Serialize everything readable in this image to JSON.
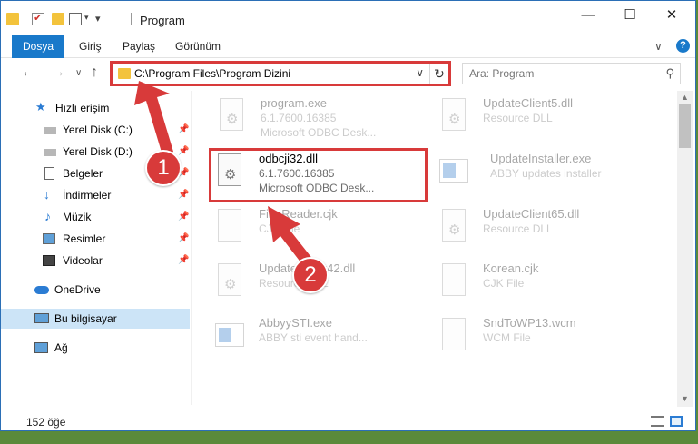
{
  "window": {
    "title": "Program"
  },
  "ribbon": {
    "tabs": [
      "Dosya",
      "Giriş",
      "Paylaş",
      "Görünüm"
    ]
  },
  "address": {
    "path": "C:\\Program Files\\Program Dizini"
  },
  "search": {
    "placeholder": "Ara: Program"
  },
  "sidebar": {
    "items": [
      {
        "label": "Hızlı erişim",
        "icon": "star-icon"
      },
      {
        "label": "Yerel Disk (C:)",
        "icon": "drive-icon"
      },
      {
        "label": "Yerel Disk (D:)",
        "icon": "drive-icon"
      },
      {
        "label": "Belgeler",
        "icon": "documents-icon"
      },
      {
        "label": "İndirmeler",
        "icon": "download-icon"
      },
      {
        "label": "Müzik",
        "icon": "music-icon"
      },
      {
        "label": "Resimler",
        "icon": "pictures-icon"
      },
      {
        "label": "Videolar",
        "icon": "videos-icon"
      },
      {
        "label": "OneDrive",
        "icon": "cloud-icon"
      },
      {
        "label": "Bu bilgisayar",
        "icon": "computer-icon"
      },
      {
        "label": "Ağ",
        "icon": "network-icon"
      }
    ]
  },
  "files": [
    {
      "name": "program.exe",
      "line1": "6.1.7600.16385",
      "line2": "Microsoft ODBC Desk...",
      "icon": "program-icon"
    },
    {
      "name": "UpdateClient5.dll",
      "line1": "Resource DLL",
      "line2": "",
      "icon": "dll-icon"
    },
    {
      "name": "odbcji32.dll",
      "line1": "6.1.7600.16385",
      "line2": "Microsoft ODBC Desk...",
      "icon": "dll-icon"
    },
    {
      "name": "UpdateInstaller.exe",
      "line1": "ABBY updates installer",
      "line2": "",
      "icon": "exe-icon"
    },
    {
      "name": "FineReader.cjk",
      "line1": "CJK File",
      "line2": "",
      "icon": "file-icon"
    },
    {
      "name": "UpdateClient65.dll",
      "line1": "Resource DLL",
      "line2": "",
      "icon": "dll-icon"
    },
    {
      "name": "UpdateClient42.dll",
      "line1": "Resource DLL",
      "line2": "",
      "icon": "dll-icon"
    },
    {
      "name": "Korean.cjk",
      "line1": "CJK File",
      "line2": "",
      "icon": "file-icon"
    },
    {
      "name": "AbbyySTI.exe",
      "line1": "ABBY sti event hand...",
      "line2": "",
      "icon": "exe-icon"
    },
    {
      "name": "SndToWP13.wcm",
      "line1": "WCM File",
      "line2": "",
      "icon": "file-icon"
    }
  ],
  "status": {
    "count": "152 öğe"
  },
  "annotations": [
    "1",
    "2"
  ],
  "colors": {
    "accent": "#1979ca",
    "highlight": "#d83a3a",
    "selection": "#cce4f7"
  }
}
